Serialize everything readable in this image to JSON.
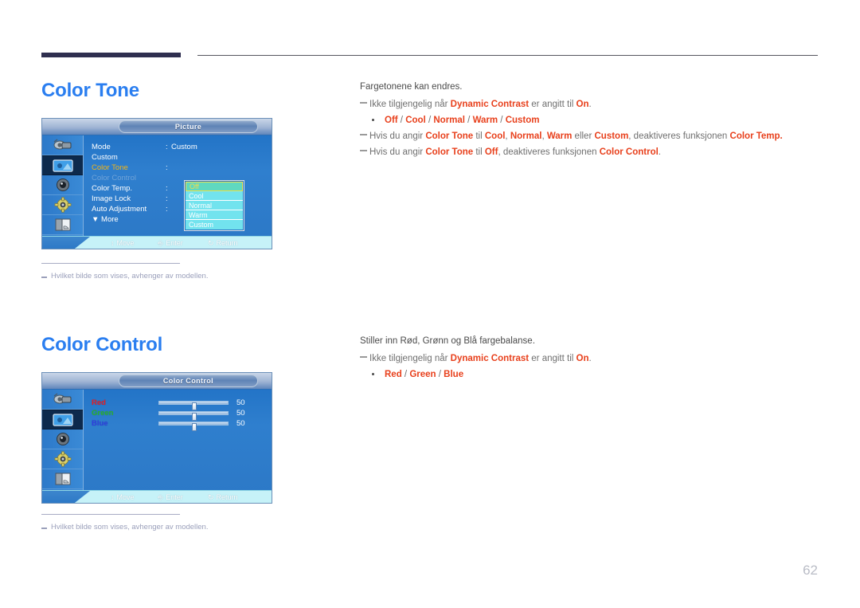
{
  "document": {
    "page_number": "62"
  },
  "sections": [
    {
      "heading": "Color Tone",
      "intro": "Fargetonene kan endres.",
      "note1_pre": "Ikke tilgjengelig når ",
      "note1_kw1": "Dynamic Contrast",
      "note1_mid": " er angitt til ",
      "note1_kw2": "On",
      "note1_end": ".",
      "bullet_items": [
        "Off",
        "Cool",
        "Normal",
        "Warm",
        "Custom"
      ],
      "note2_pre": "Hvis du angir ",
      "note2_kw1": "Color Tone",
      "note2_a": " til ",
      "note2_kw2": "Cool",
      "note2_b": ", ",
      "note2_kw3": "Normal",
      "note2_c": ", ",
      "note2_kw4": "Warm",
      "note2_d": " eller ",
      "note2_kw5": "Custom",
      "note2_e": ", deaktiveres funksjonen ",
      "note2_kw6": "Color Temp.",
      "note3_pre": "Hvis du angir ",
      "note3_kw1": "Color Tone",
      "note3_a": " til ",
      "note3_kw2": "Off",
      "note3_b": ", deaktiveres funksjonen ",
      "note3_kw3": "Color Control",
      "note3_end": ".",
      "footnote": "Hvilket bilde som vises, avhenger av modellen."
    },
    {
      "heading": "Color Control",
      "intro": "Stiller inn Rød, Grønn og Blå fargebalanse.",
      "note1_pre": "Ikke tilgjengelig når ",
      "note1_kw1": "Dynamic Contrast",
      "note1_mid": " er angitt til ",
      "note1_kw2": "On",
      "note1_end": ".",
      "bullet_items": [
        "Red",
        "Green",
        "Blue"
      ],
      "footnote": "Hvilket bilde som vises, avhenger av modellen."
    }
  ],
  "osd_picture": {
    "title": "Picture",
    "icons": [
      "input-source-icon",
      "picture-icon",
      "sound-icon",
      "setup-gear-icon",
      "multi-control-icon"
    ],
    "selected_icon_index": 1,
    "rows": [
      {
        "label": "Mode",
        "colon": ":",
        "value": "Custom",
        "state": "normal"
      },
      {
        "label": "Custom",
        "colon": "",
        "value": "",
        "state": "normal"
      },
      {
        "label": "Color Tone",
        "colon": ":",
        "value": "",
        "state": "active"
      },
      {
        "label": "Color Control",
        "colon": "",
        "value": "",
        "state": "disabled"
      },
      {
        "label": "Color Temp.",
        "colon": ":",
        "value": "",
        "state": "normal"
      },
      {
        "label": "Image Lock",
        "colon": ":",
        "value": "",
        "state": "normal"
      },
      {
        "label": "Auto Adjustment",
        "colon": ":",
        "value": "",
        "state": "normal"
      },
      {
        "label": "▼ More",
        "colon": "",
        "value": "",
        "state": "more"
      }
    ],
    "dropdown": {
      "items": [
        "Off",
        "Cool",
        "Normal",
        "Warm",
        "Custom"
      ],
      "selected_index": 0
    },
    "footer": {
      "move": "Move",
      "enter": "Enter",
      "return": "Return"
    }
  },
  "osd_color_control": {
    "title": "Color Control",
    "icons": [
      "input-source-icon",
      "picture-icon",
      "sound-icon",
      "setup-gear-icon",
      "multi-control-icon"
    ],
    "selected_icon_index": 1,
    "sliders": [
      {
        "label": "Red",
        "value": "50"
      },
      {
        "label": "Green",
        "value": "50"
      },
      {
        "label": "Blue",
        "value": "50"
      }
    ],
    "footer": {
      "move": "Move",
      "enter": "Enter",
      "return": "Return"
    }
  },
  "colors": {
    "heading_blue": "#2a7ef0",
    "keyword_red": "#e8401c",
    "rule_navy": "#2f2f4f",
    "osd_blue": "#2c78c6",
    "dropdown_cyan": "#72e3ee",
    "highlight_yellow": "#f0e24a"
  }
}
